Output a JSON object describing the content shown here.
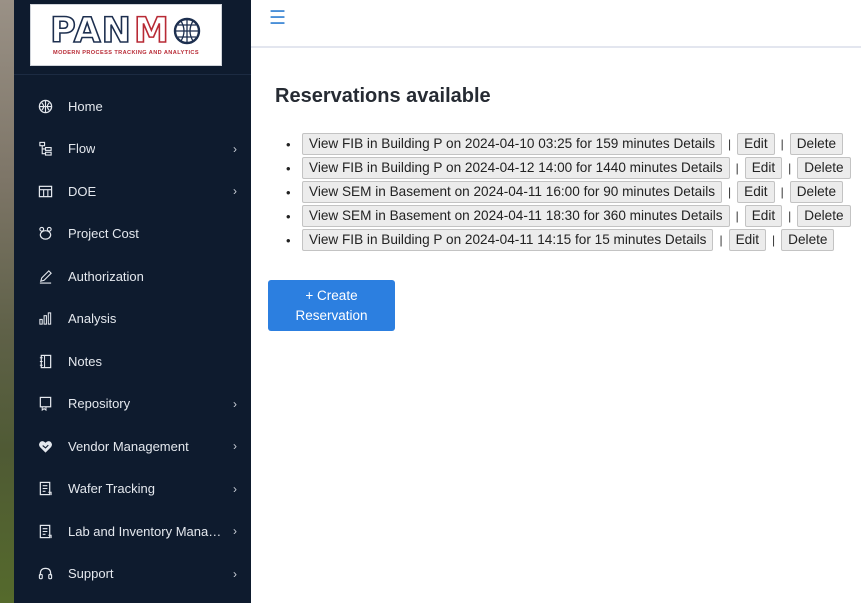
{
  "brand": {
    "logo_text_left": "PAN",
    "logo_text_right": "M",
    "tagline": "MODERN PROCESS TRACKING AND ANALYTICS"
  },
  "sidebar": {
    "items": [
      {
        "label": "Home",
        "icon": "globe-icon",
        "has_submenu": false
      },
      {
        "label": "Flow",
        "icon": "flow-tree-icon",
        "has_submenu": true
      },
      {
        "label": "DOE",
        "icon": "table-grid-icon",
        "has_submenu": true
      },
      {
        "label": "Project Cost",
        "icon": "piggy-bank-icon",
        "has_submenu": false
      },
      {
        "label": "Authorization",
        "icon": "pencil-icon",
        "has_submenu": false
      },
      {
        "label": "Analysis",
        "icon": "bar-chart-icon",
        "has_submenu": false
      },
      {
        "label": "Notes",
        "icon": "notebook-icon",
        "has_submenu": false
      },
      {
        "label": "Repository",
        "icon": "repository-icon",
        "has_submenu": true
      },
      {
        "label": "Vendor Management",
        "icon": "handshake-heart-icon",
        "has_submenu": true
      },
      {
        "label": "Wafer Tracking",
        "icon": "document-list-icon",
        "has_submenu": true
      },
      {
        "label": "Lab and Inventory Manage...",
        "icon": "document-list-icon",
        "has_submenu": true
      },
      {
        "label": "Support",
        "icon": "headset-icon",
        "has_submenu": true
      }
    ],
    "chevron": "›"
  },
  "header": {
    "menu_icon": "☰"
  },
  "main": {
    "title": "Reservations available",
    "separator": "|",
    "reservations": [
      {
        "view_label": "View FIB in Building P on 2024-04-10 03:25 for 159 minutes Details",
        "edit_label": "Edit",
        "delete_label": "Delete"
      },
      {
        "view_label": "View FIB in Building P on 2024-04-12 14:00 for 1440 minutes Details",
        "edit_label": "Edit",
        "delete_label": "Delete"
      },
      {
        "view_label": "View SEM in Basement on 2024-04-11 16:00 for 90 minutes Details",
        "edit_label": "Edit",
        "delete_label": "Delete"
      },
      {
        "view_label": "View SEM in Basement on 2024-04-11 18:30 for 360 minutes Details",
        "edit_label": "Edit",
        "delete_label": "Delete"
      },
      {
        "view_label": "View FIB in Building P on 2024-04-11 14:15 for 15 minutes Details",
        "edit_label": "Edit",
        "delete_label": "Delete"
      }
    ],
    "create_button_label": "+ Create Reservation"
  },
  "colors": {
    "sidebar_bg": "#0e1b2e",
    "accent_blue": "#2c7fe0",
    "logo_navy": "#1d2f4f",
    "logo_red": "#b82a35"
  }
}
